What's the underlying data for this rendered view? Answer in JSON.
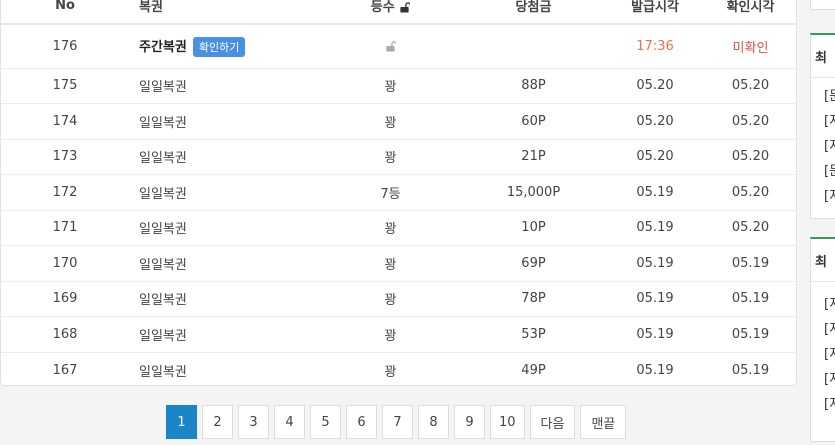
{
  "table": {
    "headers": {
      "no": "No",
      "name": "복권",
      "rank": "등수",
      "prize": "당첨금",
      "issued": "발급시각",
      "checked": "확인시각"
    },
    "rows": [
      {
        "no": "176",
        "name": "주간복권",
        "badge": "확인하기",
        "rank": "",
        "prize": "",
        "issued": "17:36",
        "checked": "미확인"
      },
      {
        "no": "175",
        "name": "일일복권",
        "rank": "꽝",
        "prize": "88P",
        "issued": "05.20",
        "checked": "05.20"
      },
      {
        "no": "174",
        "name": "일일복권",
        "rank": "꽝",
        "prize": "60P",
        "issued": "05.20",
        "checked": "05.20"
      },
      {
        "no": "173",
        "name": "일일복권",
        "rank": "꽝",
        "prize": "21P",
        "issued": "05.20",
        "checked": "05.20"
      },
      {
        "no": "172",
        "name": "일일복권",
        "rank": "7등",
        "prize": "15,000P",
        "issued": "05.19",
        "checked": "05.20"
      },
      {
        "no": "171",
        "name": "일일복권",
        "rank": "꽝",
        "prize": "10P",
        "issued": "05.19",
        "checked": "05.20"
      },
      {
        "no": "170",
        "name": "일일복권",
        "rank": "꽝",
        "prize": "69P",
        "issued": "05.19",
        "checked": "05.19"
      },
      {
        "no": "169",
        "name": "일일복권",
        "rank": "꽝",
        "prize": "78P",
        "issued": "05.19",
        "checked": "05.19"
      },
      {
        "no": "168",
        "name": "일일복권",
        "rank": "꽝",
        "prize": "53P",
        "issued": "05.19",
        "checked": "05.19"
      },
      {
        "no": "167",
        "name": "일일복권",
        "rank": "꽝",
        "prize": "49P",
        "issued": "05.19",
        "checked": "05.19"
      }
    ]
  },
  "pagination": {
    "pages": [
      "1",
      "2",
      "3",
      "4",
      "5",
      "6",
      "7",
      "8",
      "9",
      "10"
    ],
    "active": "1",
    "next_label": "다음",
    "last_label": "맨끝"
  },
  "sidebar": {
    "panel_a": {
      "title": "최",
      "items": [
        "[문",
        "[지",
        "[지",
        "[문",
        "[지"
      ]
    },
    "panel_b": {
      "title": "최",
      "items": [
        "[지",
        "[지",
        "[지",
        "[지",
        "[지"
      ]
    }
  },
  "colors": {
    "accent": "#1a86c8",
    "badge": "#4a90e2",
    "time_new": "#e8754b",
    "unchecked": "#d9534f",
    "panel_border": "#3a9a52"
  }
}
